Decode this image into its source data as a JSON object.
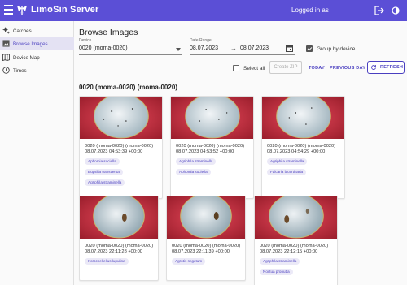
{
  "app": {
    "title": "LimoSin Server",
    "status": "Logged in as",
    "accent": "#5b4fd6"
  },
  "sidebar": {
    "items": [
      {
        "label": "Catches",
        "icon": "sparkle-icon",
        "active": false
      },
      {
        "label": "Browse Images",
        "icon": "image-icon",
        "active": true
      },
      {
        "label": "Device Map",
        "icon": "map-icon",
        "active": false
      },
      {
        "label": "Times",
        "icon": "clock-icon",
        "active": false
      }
    ]
  },
  "page": {
    "title": "Browse Images"
  },
  "filters": {
    "device_label": "Device",
    "device_value": "0020 (moma-0020)",
    "date_label": "Date Range",
    "date_from": "08.07.2023",
    "date_arrow": "→",
    "date_to": "08.07.2023",
    "group_label": "Group by device",
    "group_checked": true
  },
  "toolbar": {
    "select_all": "Select all",
    "create_zip": "Create ZIP",
    "today": "TODAY",
    "previous_day": "PREVIOUS DAY",
    "refresh": "REFRESH"
  },
  "group": {
    "title": "0020 (moma-0020) (moma-0020)"
  },
  "cards": [
    {
      "device": "0020 (moma-0020) (moma-0020)",
      "timestamp": "08.07.2023 04:53:39 +00:00",
      "tags": [
        "Aphomia sociella",
        "Eupsilia transversa",
        "Agriphila straminella"
      ]
    },
    {
      "device": "0020 (moma-0020) (moma-0020)",
      "timestamp": "08.07.2023 04:53:52 +00:00",
      "tags": [
        "Agriphila straminella",
        "Aphomia sociella"
      ]
    },
    {
      "device": "0020 (moma-0020) (moma-0020)",
      "timestamp": "08.07.2023 04:54:29 +00:00",
      "tags": [
        "Agriphila straminella",
        "Falcaria lacertinaria"
      ]
    },
    {
      "device": "0020 (moma-0020) (moma-0020)",
      "timestamp": "08.07.2023 22:11:28 +00:00",
      "tags": [
        "Korscheltellus lupulina"
      ]
    },
    {
      "device": "0020 (moma-0020) (moma-0020)",
      "timestamp": "08.07.2023 22:11:39 +00:00",
      "tags": [
        "Agrotis segetum"
      ]
    },
    {
      "device": "0020 (moma-0020) (moma-0020)",
      "timestamp": "08.07.2023 22:12:15 +00:00",
      "tags": [
        "Agriphila straminella",
        "Noctua pronuba"
      ]
    }
  ]
}
